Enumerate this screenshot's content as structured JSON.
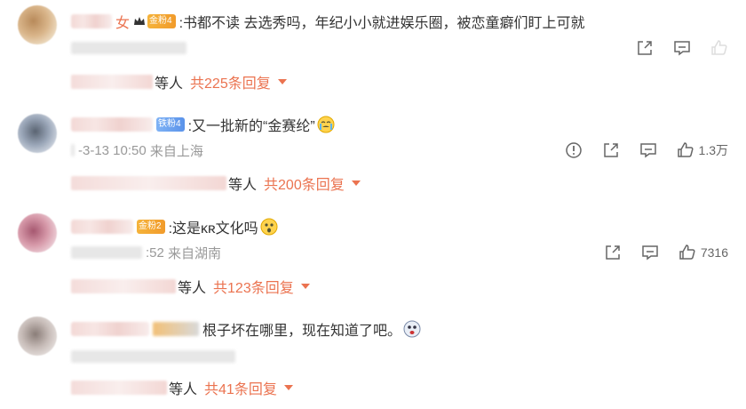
{
  "comments": [
    {
      "name_char": "女",
      "badge": "金粉4",
      "text": ":书都不读  去选秀吗，年纪小小就进娱乐圈，被恋童癖们盯上可就",
      "time": "",
      "location": "",
      "likes": "",
      "replies_who": "等人",
      "replies_count": "共225条回复"
    },
    {
      "name_char": "",
      "badge": "铁粉4",
      "text": ":又一批新的“金赛纶”",
      "time": "-3-13 10:50",
      "location": "来自上海",
      "likes": "1.3万",
      "replies_who": "等人",
      "replies_count": "共200条回复"
    },
    {
      "name_char": "",
      "badge": "金粉2",
      "text": ":这是ᴋʀ文化吗",
      "time": ":52",
      "location": "来自湖南",
      "likes": "7316",
      "replies_who": "等人",
      "replies_count": "共123条回复"
    },
    {
      "name_char": "",
      "badge": "",
      "text": "根子坏在哪里，现在知道了吧。",
      "time": "",
      "location": "",
      "likes": "",
      "replies_who": "等人",
      "replies_count": "共41条回复"
    }
  ],
  "icons": [
    "report-icon",
    "share-icon",
    "comment-icon",
    "like-icon",
    "crown-icon",
    "badge-icon"
  ],
  "colors": {
    "accent": "#eb7350",
    "gold_badge": "#f5b33a",
    "blue_badge": "#5a93ea",
    "meta": "#999999"
  }
}
